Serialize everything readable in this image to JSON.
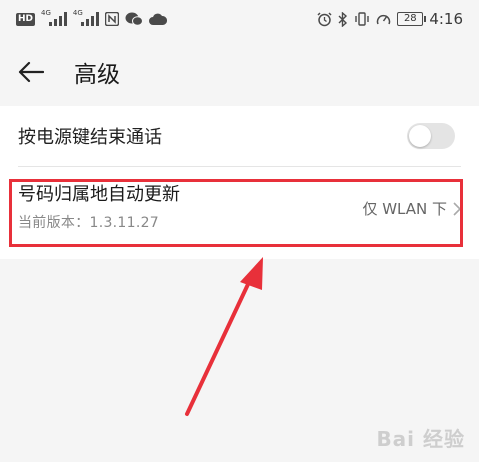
{
  "status_bar": {
    "hd": "HD",
    "net1": "4G",
    "net2": "4G",
    "battery": "28",
    "time": "4:16"
  },
  "header": {
    "title": "高级"
  },
  "settings": {
    "power_key_end_call": {
      "label": "按电源键结束通话",
      "enabled": false
    },
    "number_location_update": {
      "title": "号码归属地自动更新",
      "subtitle": "当前版本：1.3.11.27",
      "value": "仅 WLAN 下"
    }
  },
  "watermark": "Bai 经验",
  "colors": {
    "highlight": "#e8303a",
    "background": "#f5f5f5",
    "card": "#ffffff"
  }
}
